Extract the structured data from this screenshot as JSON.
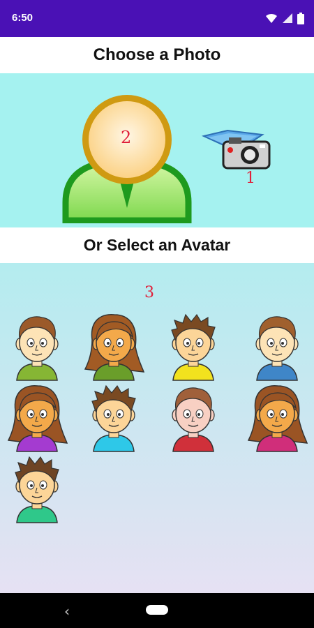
{
  "status_bar": {
    "time": "6:50",
    "icons": [
      "wifi-icon",
      "signal-icon",
      "battery-icon"
    ]
  },
  "header": {
    "title": "Choose a Photo"
  },
  "photo_section": {
    "placeholder_number": "2",
    "camera_number": "1",
    "icons": [
      "user-placeholder-icon",
      "camera-icon"
    ]
  },
  "avatar_section": {
    "title": "Or Select an Avatar",
    "grid_number": "3",
    "avatars": [
      {
        "hair": "short",
        "shirt": "#86b634",
        "skin": "#fde3b6",
        "hair_color": "#9b5a2a"
      },
      {
        "hair": "long",
        "shirt": "#6a9e2a",
        "skin": "#f3a94a",
        "hair_color": "#a25b24"
      },
      {
        "hair": "spiky",
        "shirt": "#f2e21e",
        "skin": "#fcd598",
        "hair_color": "#7a4a22"
      },
      {
        "hair": "short",
        "shirt": "#3f86c8",
        "skin": "#fde3b6",
        "hair_color": "#a0602e"
      },
      {
        "hair": "long",
        "shirt": "#a43bd0",
        "skin": "#f3a94a",
        "hair_color": "#9a5424"
      },
      {
        "hair": "spiky",
        "shirt": "#2ec8e8",
        "skin": "#fcd598",
        "hair_color": "#7a4a22"
      },
      {
        "hair": "short",
        "shirt": "#d0303a",
        "skin": "#f8d0c3",
        "hair_color": "#a0603a"
      },
      {
        "hair": "long",
        "shirt": "#d02e7a",
        "skin": "#f3a94a",
        "hair_color": "#9a5424"
      },
      {
        "hair": "spiky",
        "shirt": "#2fc88a",
        "skin": "#fcd598",
        "hair_color": "#6e4424"
      }
    ]
  },
  "colors": {
    "status_bar": "#4a11b5",
    "photo_background": "#a5f2f0",
    "number_label": "#e0203a",
    "placeholder_ring": "#cf9a12",
    "placeholder_body": "#2e9e2a"
  },
  "nav_bar": {
    "buttons": [
      "back-icon",
      "home-pill"
    ]
  }
}
